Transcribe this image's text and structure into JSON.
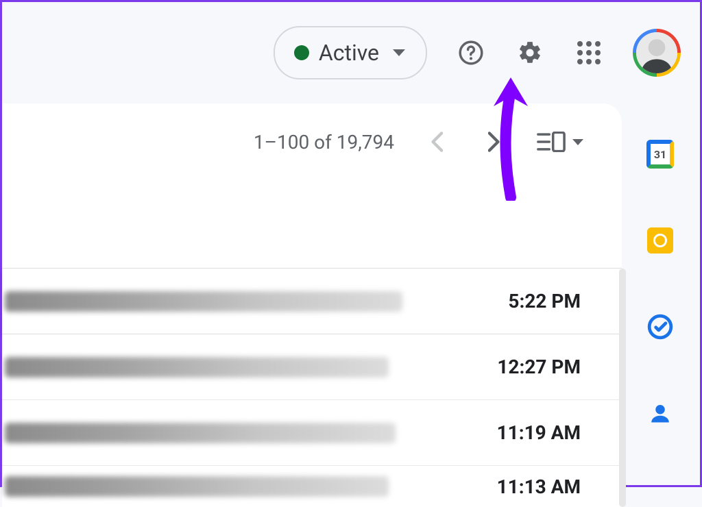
{
  "header": {
    "status": {
      "label": "Active",
      "color": "#137333"
    }
  },
  "toolbar": {
    "pager_text": "1–100 of 19,794"
  },
  "sidepanel": {
    "calendar_day": "31"
  },
  "emails": [
    {
      "time": "5:22 PM"
    },
    {
      "time": "12:27 PM"
    },
    {
      "time": "11:19 AM"
    },
    {
      "time": "11:13 AM"
    }
  ]
}
